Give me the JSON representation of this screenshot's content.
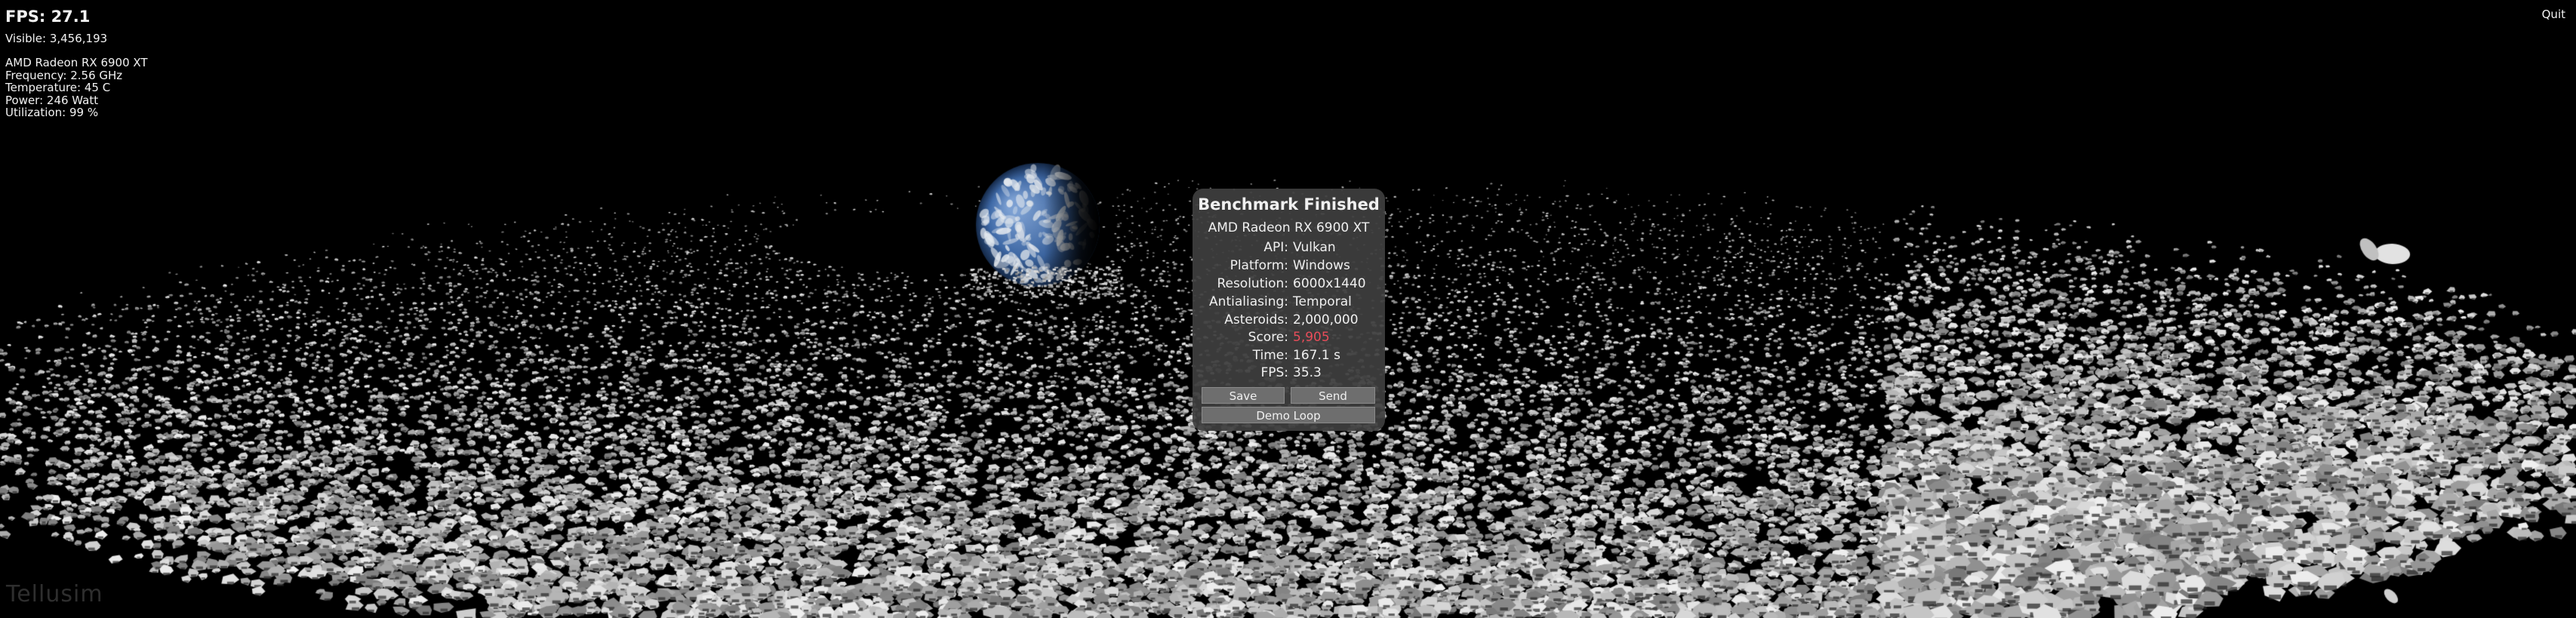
{
  "hud": {
    "fps": "FPS: 27.1",
    "visible": "Visible: 3,456,193",
    "gpu_name": "AMD Radeon RX 6900 XT",
    "frequency": "Frequency: 2.56 GHz",
    "temperature": "Temperature: 45 C",
    "power": "Power: 246 Watt",
    "utilization": "Utilization: 99 %",
    "quit_label": "Quit"
  },
  "watermark": "Tellusim",
  "results_panel": {
    "title": "Benchmark Finished",
    "gpu": "AMD Radeon RX 6900 XT",
    "rows": [
      {
        "label": "API:",
        "value": "Vulkan"
      },
      {
        "label": "Platform:",
        "value": "Windows"
      },
      {
        "label": "Resolution:",
        "value": "6000x1440"
      },
      {
        "label": "Antialiasing:",
        "value": "Temporal"
      },
      {
        "label": "Asteroids:",
        "value": "2,000,000"
      },
      {
        "label": "Score:",
        "value": "5,905"
      },
      {
        "label": "Time:",
        "value": "167.1 s"
      },
      {
        "label": "FPS:",
        "value": "35.3"
      }
    ],
    "buttons": {
      "save": "Save",
      "send": "Send",
      "demo_loop": "Demo Loop"
    },
    "colors": {
      "score": "#e84d5a",
      "panel_bg": "#3e3e3e"
    }
  }
}
